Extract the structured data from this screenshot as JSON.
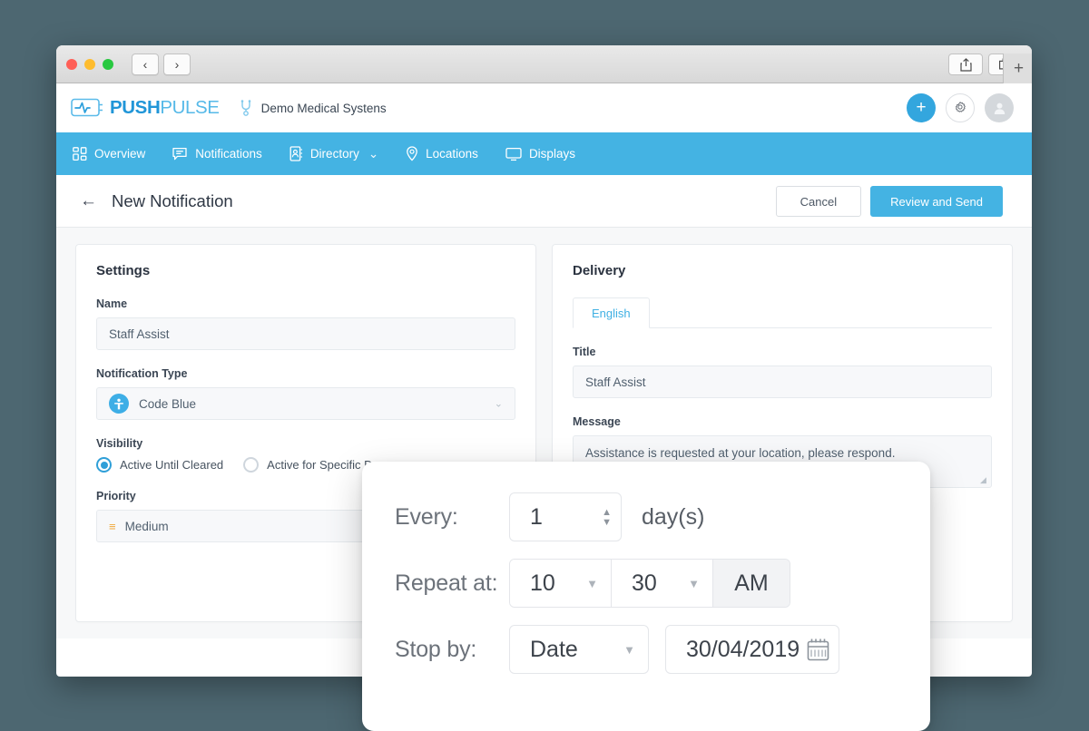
{
  "browser": {
    "traffic_lights": [
      "close",
      "minimize",
      "maximize"
    ],
    "back_label": "‹",
    "forward_label": "›",
    "share_icon": "share-icon",
    "tabs_icon": "tabs-icon",
    "new_tab_label": "+"
  },
  "header": {
    "logo_icon": "pulse-monitor-icon",
    "logo_push": "PUSH",
    "logo_pulse": "PULSE",
    "org_icon": "stethoscope-icon",
    "org_name": "Demo Medical Systens",
    "add_label": "+",
    "gear_icon": "gear-icon",
    "avatar_icon": "user-avatar-icon",
    "accent_color": "#44b3e3"
  },
  "nav": {
    "items": [
      {
        "label": "Overview",
        "icon": "grid-icon",
        "caret": false
      },
      {
        "label": "Notifications",
        "icon": "chat-icon",
        "caret": false
      },
      {
        "label": "Directory",
        "icon": "contacts-icon",
        "caret": true
      },
      {
        "label": "Locations",
        "icon": "pin-icon",
        "caret": false
      },
      {
        "label": "Displays",
        "icon": "monitor-icon",
        "caret": false
      }
    ],
    "caret_glyph": "⌄"
  },
  "page": {
    "back_glyph": "←",
    "title": "New Notification",
    "cancel_label": "Cancel",
    "primary_label": "Review and Send"
  },
  "settings": {
    "title": "Settings",
    "name_label": "Name",
    "name_value": "Staff Assist",
    "type_label": "Notification Type",
    "type_value": "Code Blue",
    "type_icon": "code-blue-person-icon",
    "visibility_label": "Visibility",
    "visibility_options": [
      {
        "label": "Active Until Cleared",
        "selected": true
      },
      {
        "label": "Active for Specific Dur",
        "selected": false
      }
    ],
    "priority_label": "Priority",
    "priority_value": "Medium",
    "priority_icon": "equals-medium-icon",
    "priority_color": "#f0a83c",
    "caret_glyph": "⌄"
  },
  "delivery": {
    "title": "Delivery",
    "tabs": [
      {
        "label": "English",
        "active": true
      }
    ],
    "title_label": "Title",
    "title_value": "Staff Assist",
    "message_label": "Message",
    "message_value": "Assistance is requested at your location, please respond."
  },
  "overlay": {
    "every_label": "Every:",
    "every_value": "1",
    "every_unit": "day(s)",
    "spin_up": "▲",
    "spin_down": "▼",
    "repeat_label": "Repeat at:",
    "repeat_hour": "10",
    "repeat_minute": "30",
    "repeat_meridiem": "AM",
    "stop_label": "Stop by:",
    "stop_mode": "Date",
    "stop_date": "30/04/2019",
    "calendar_icon": "calendar-icon",
    "caret_glyph": "▼"
  }
}
